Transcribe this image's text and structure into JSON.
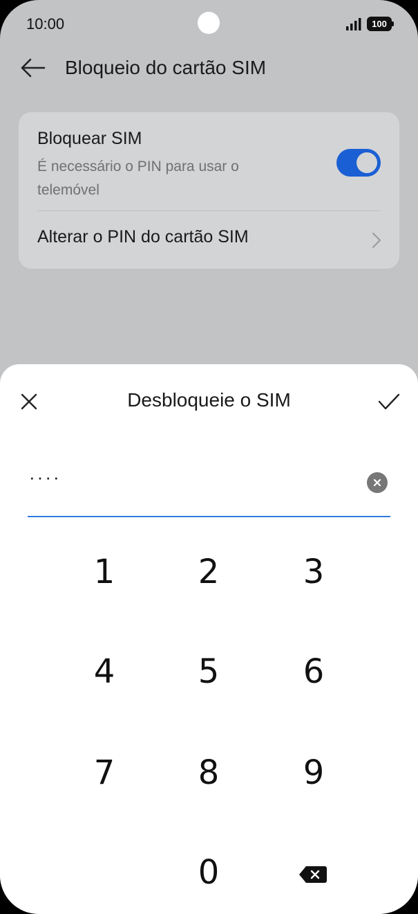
{
  "status_bar": {
    "time": "10:00",
    "battery": "100"
  },
  "header": {
    "title": "Bloqueio do cartão SIM"
  },
  "settings": {
    "lock_sim": {
      "title": "Bloquear SIM",
      "subtitle": "É necessário o PIN para usar o telemóvel",
      "enabled": true
    },
    "change_pin": {
      "label": "Alterar o PIN do cartão SIM"
    }
  },
  "dialog": {
    "title": "Desbloqueie o SIM",
    "pin_masked": "····",
    "keypad": [
      "1",
      "2",
      "3",
      "4",
      "5",
      "6",
      "7",
      "8",
      "9",
      "0"
    ]
  },
  "colors": {
    "accent": "#1a5fd4",
    "input_underline": "#2e7be0",
    "overlay_bg": "#c2c3c5"
  }
}
